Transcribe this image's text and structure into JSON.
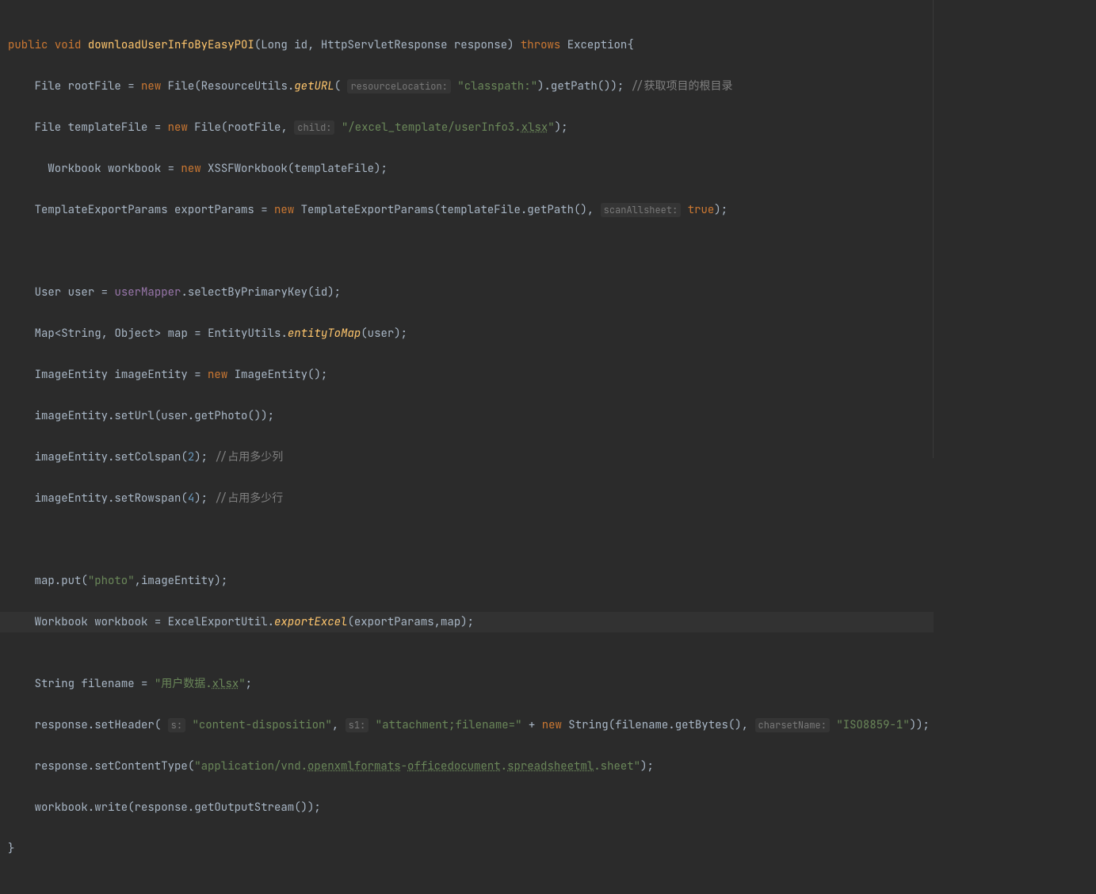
{
  "code": {
    "kw_public": "public",
    "kw_void": "void",
    "method_name": "downloadUserInfoByEasyPOI",
    "param1_type": "Long",
    "param1_name": "id",
    "param2_type": "HttpServletResponse",
    "param2_name": "response",
    "kw_throws": "throws",
    "exception": "Exception",
    "type_file": "File",
    "var_rootFile": "rootFile",
    "kw_new": "new",
    "class_File": "File",
    "class_ResourceUtils": "ResourceUtils",
    "method_getURL": "getURL",
    "hint_resourceLocation": "resourceLocation:",
    "str_classpath": "\"classpath:\"",
    "method_getPath": "getPath",
    "comment_root": "//获取项目的根目录",
    "var_templateFile": "templateFile",
    "hint_child": "child:",
    "str_template_path": "\"/excel_template/userInfo3.",
    "str_xlsx": "xlsx",
    "type_workbook": "Workbook",
    "var_workbook": "workbook",
    "class_XSSFWorkbook": "XSSFWorkbook",
    "type_TemplateExportParams": "TemplateExportParams",
    "var_exportParams": "exportParams",
    "class_TemplateExportParams": "TemplateExportParams",
    "hint_scanAllsheet": "scanAllsheet:",
    "kw_true": "true",
    "type_User": "User",
    "var_user": "user",
    "field_userMapper": "userMapper",
    "method_selectByPrimaryKey": "selectByPrimaryKey",
    "type_Map": "Map",
    "type_String": "String",
    "type_Object": "Object",
    "var_map": "map",
    "class_EntityUtils": "EntityUtils",
    "method_entityToMap": "entityToMap",
    "type_ImageEntity": "ImageEntity",
    "var_imageEntity": "imageEntity",
    "class_ImageEntity": "ImageEntity",
    "method_setUrl": "setUrl",
    "method_getPhoto": "getPhoto",
    "method_setColspan": "setColspan",
    "num_2": "2",
    "comment_cols": "//占用多少列",
    "method_setRowspan": "setRowspan",
    "num_4": "4",
    "comment_rows": "//占用多少行",
    "method_put": "put",
    "str_photo": "\"photo\"",
    "class_ExcelExportUtil": "ExcelExportUtil",
    "method_exportExcel": "exportExcel",
    "var_filename": "filename",
    "str_userdata": "\"用户数据.",
    "method_setHeader": "setHeader",
    "hint_s": "s:",
    "str_content_disposition": "\"content-disposition\"",
    "hint_s1": "s1:",
    "str_attachment": "\"attachment;filename=\"",
    "method_getBytes": "getBytes",
    "hint_charsetName": "charsetName:",
    "str_iso": "\"ISO8859-1\"",
    "method_setContentType": "setContentType",
    "str_content_type_prefix": "\"application/vnd.",
    "str_openxml": "openxmlformats",
    "str_office": "officedocument",
    "str_spreadsheet": "spreadsheetml",
    "str_sheet_suffix": ".sheet\"",
    "method_write": "write",
    "method_getOutputStream": "getOutputStream"
  }
}
